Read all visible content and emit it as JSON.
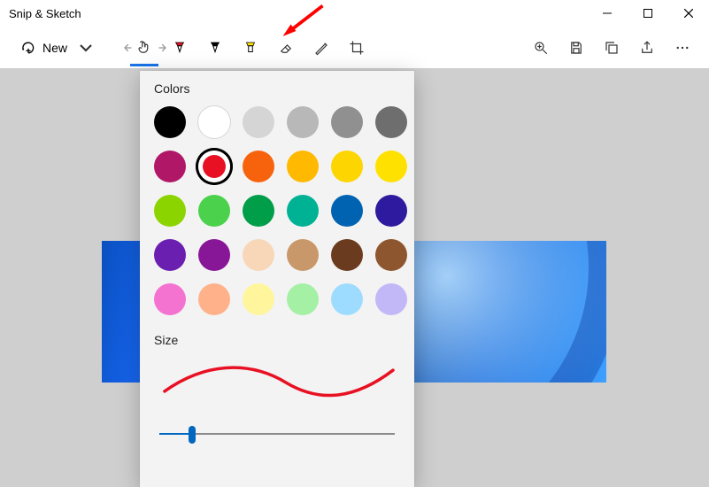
{
  "app": {
    "title": "Snip & Sketch"
  },
  "toolbar": {
    "new_label": "New"
  },
  "popup": {
    "colors_label": "Colors",
    "size_label": "Size",
    "colors": [
      {
        "name": "black",
        "hex": "#000000"
      },
      {
        "name": "white",
        "hex": "#ffffff",
        "white": true
      },
      {
        "name": "silver",
        "hex": "#d5d5d5"
      },
      {
        "name": "gray-light",
        "hex": "#b8b8b8"
      },
      {
        "name": "gray",
        "hex": "#909090"
      },
      {
        "name": "gray-dark",
        "hex": "#6e6e6e"
      },
      {
        "name": "magenta-dark",
        "hex": "#b01766"
      },
      {
        "name": "red",
        "hex": "#e81123",
        "selected": true
      },
      {
        "name": "orange",
        "hex": "#f7630c"
      },
      {
        "name": "gold",
        "hex": "#ffb900"
      },
      {
        "name": "amber",
        "hex": "#fdd500"
      },
      {
        "name": "yellow",
        "hex": "#ffe100"
      },
      {
        "name": "lime",
        "hex": "#8cd400"
      },
      {
        "name": "green-light",
        "hex": "#4bd14b"
      },
      {
        "name": "green",
        "hex": "#009e49"
      },
      {
        "name": "teal",
        "hex": "#00b294"
      },
      {
        "name": "blue",
        "hex": "#0063b1"
      },
      {
        "name": "indigo",
        "hex": "#2e1a9e"
      },
      {
        "name": "violet",
        "hex": "#6b1fb0"
      },
      {
        "name": "purple",
        "hex": "#881798"
      },
      {
        "name": "beige",
        "hex": "#f7d7b8"
      },
      {
        "name": "tan",
        "hex": "#c9986a"
      },
      {
        "name": "brown-dark",
        "hex": "#6b3b1f"
      },
      {
        "name": "brown",
        "hex": "#8e562e"
      },
      {
        "name": "pink",
        "hex": "#f472d0"
      },
      {
        "name": "peach",
        "hex": "#ffb28a"
      },
      {
        "name": "yellow-light",
        "hex": "#fff59d"
      },
      {
        "name": "mint",
        "hex": "#a4f0a4"
      },
      {
        "name": "sky",
        "hex": "#9edcff"
      },
      {
        "name": "lavender",
        "hex": "#c3b8f7"
      }
    ],
    "slider": {
      "min": 0,
      "max": 100,
      "value": 14
    }
  }
}
